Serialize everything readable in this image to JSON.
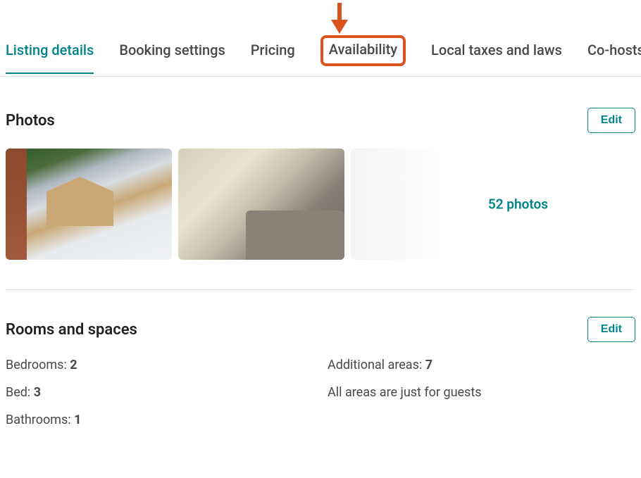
{
  "annotation": {
    "arrow_color": "#d9531e"
  },
  "tabs": [
    {
      "label": "Listing details",
      "active": true,
      "highlighted": false
    },
    {
      "label": "Booking settings",
      "active": false,
      "highlighted": false
    },
    {
      "label": "Pricing",
      "active": false,
      "highlighted": false
    },
    {
      "label": "Availability",
      "active": false,
      "highlighted": true
    },
    {
      "label": "Local taxes and laws",
      "active": false,
      "highlighted": false
    },
    {
      "label": "Co-hosts",
      "active": false,
      "highlighted": false
    }
  ],
  "photos": {
    "title": "Photos",
    "edit_label": "Edit",
    "count_label": "52 photos"
  },
  "rooms": {
    "title": "Rooms and spaces",
    "edit_label": "Edit",
    "left": [
      {
        "label": "Bedrooms: ",
        "value": "2"
      },
      {
        "label": "Bed: ",
        "value": "3"
      },
      {
        "label": "Bathrooms: ",
        "value": "1"
      }
    ],
    "right": [
      {
        "label": "Additional areas: ",
        "value": "7"
      },
      {
        "label": "All areas are just for guests",
        "value": ""
      }
    ]
  }
}
